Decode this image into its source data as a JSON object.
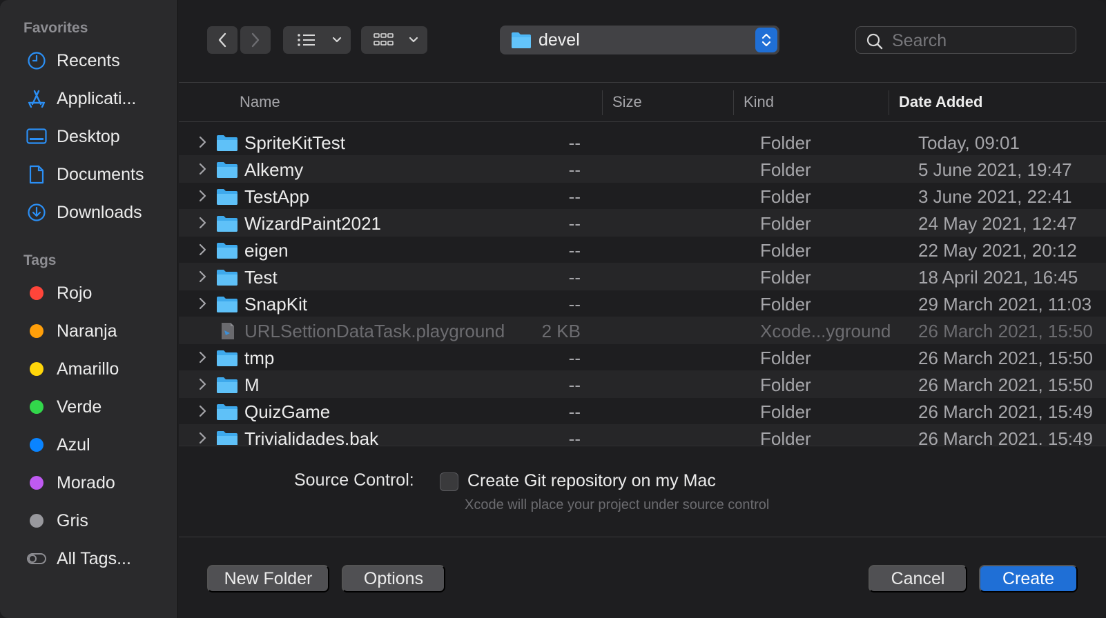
{
  "sidebar": {
    "favorites_header": "Favorites",
    "favorites": [
      {
        "label": "Recents",
        "icon": "clock-icon"
      },
      {
        "label": "Applicati...",
        "icon": "applications-icon"
      },
      {
        "label": "Desktop",
        "icon": "desktop-icon"
      },
      {
        "label": "Documents",
        "icon": "document-icon"
      },
      {
        "label": "Downloads",
        "icon": "download-icon"
      }
    ],
    "tags_header": "Tags",
    "tags": [
      {
        "label": "Rojo",
        "color": "#ff453a"
      },
      {
        "label": "Naranja",
        "color": "#ff9f0a"
      },
      {
        "label": "Amarillo",
        "color": "#ffd60a"
      },
      {
        "label": "Verde",
        "color": "#32d74b"
      },
      {
        "label": "Azul",
        "color": "#0a84ff"
      },
      {
        "label": "Morado",
        "color": "#bf5af2"
      },
      {
        "label": "Gris",
        "color": "#98989d"
      }
    ],
    "all_tags": "All Tags..."
  },
  "toolbar": {
    "path": "devel",
    "search_placeholder": "Search"
  },
  "columns": {
    "name": "Name",
    "size": "Size",
    "kind": "Kind",
    "date": "Date Added"
  },
  "files": [
    {
      "name": "SpriteKitTest",
      "size": "--",
      "kind": "Folder",
      "date": "Today, 09:01"
    },
    {
      "name": "Alkemy",
      "size": "--",
      "kind": "Folder",
      "date": "5 June 2021, 19:47"
    },
    {
      "name": "TestApp",
      "size": "--",
      "kind": "Folder",
      "date": "3 June 2021, 22:41"
    },
    {
      "name": "WizardPaint2021",
      "size": "--",
      "kind": "Folder",
      "date": "24 May 2021, 12:47"
    },
    {
      "name": "eigen",
      "size": "--",
      "kind": "Folder",
      "date": "22 May 2021, 20:12"
    },
    {
      "name": "Test",
      "size": "--",
      "kind": "Folder",
      "date": "18 April 2021, 16:45"
    },
    {
      "name": "SnapKit",
      "size": "--",
      "kind": "Folder",
      "date": "29 March 2021, 11:03"
    },
    {
      "name": "URLSettionDataTask.playground",
      "size": "2 KB",
      "kind": "Xcode...yground",
      "date": "26 March 2021, 15:50"
    },
    {
      "name": "tmp",
      "size": "--",
      "kind": "Folder",
      "date": "26 March 2021, 15:50"
    },
    {
      "name": "M",
      "size": "--",
      "kind": "Folder",
      "date": "26 March 2021, 15:50"
    },
    {
      "name": "QuizGame",
      "size": "--",
      "kind": "Folder",
      "date": "26 March 2021, 15:49"
    },
    {
      "name": "Trivialidades.bak",
      "size": "--",
      "kind": "Folder",
      "date": "26 March 2021, 15:49"
    }
  ],
  "source_control": {
    "label": "Source Control:",
    "checkbox_label": "Create Git repository on my Mac",
    "hint": "Xcode will place your project under source control"
  },
  "buttons": {
    "new_folder": "New Folder",
    "options": "Options",
    "cancel": "Cancel",
    "create": "Create"
  }
}
